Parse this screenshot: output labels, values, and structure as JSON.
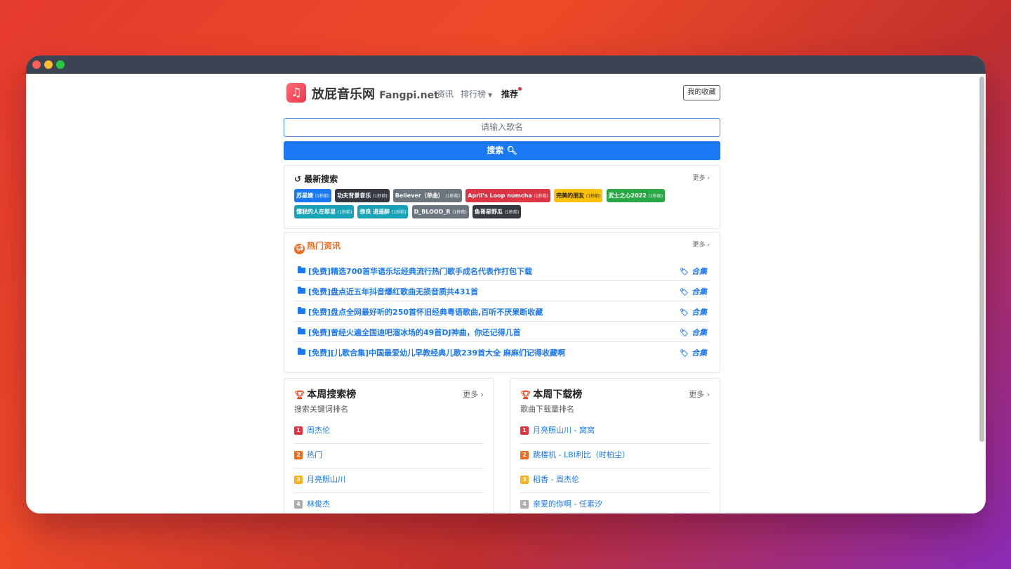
{
  "window": {
    "controls": [
      "close",
      "minimize",
      "maximize"
    ]
  },
  "nav": {
    "brand_cn": "放屁音乐网",
    "brand_en": "Fangpi.net",
    "logo_icon": "music-note-icon",
    "links": [
      "资讯",
      "排行榜",
      "推荐"
    ],
    "fav_button": "我的收藏"
  },
  "search": {
    "placeholder": "请输入歌名",
    "button_label": "搜索"
  },
  "recent": {
    "title": "最新搜索",
    "more": "更多",
    "tags": [
      {
        "name": "苏星婕",
        "time": "(1秒前)",
        "color": "#1a78f2"
      },
      {
        "name": "功夫背景音乐",
        "time": "(1秒前)",
        "color": "#343a40"
      },
      {
        "name": "Believer（单曲）",
        "time": "(1秒前)",
        "color": "#6c757d"
      },
      {
        "name": "April's Loop numcha",
        "time": "(1秒前)",
        "color": "#dc3545"
      },
      {
        "name": "完美的朋友",
        "time": "(1秒前)",
        "color": "#ffc107"
      },
      {
        "name": "武士之心2022",
        "time": "(1秒前)",
        "color": "#28a745"
      },
      {
        "name": "懂我的人在那里",
        "time": "(1秒前)",
        "color": "#17a2b8"
      },
      {
        "name": "徐良 逍遥醉",
        "time": "(1秒前)",
        "color": "#17a2b8"
      },
      {
        "name": "D_BLOOD_R",
        "time": "(1秒前)",
        "color": "#6c757d"
      },
      {
        "name": "鱼哥星野瓜",
        "time": "(1秒前)",
        "color": "#343a40"
      }
    ]
  },
  "hot": {
    "title": "热门资讯",
    "more": "更多",
    "items": [
      {
        "text": "[免费]精选700首华语乐坛经典流行热门歌手成名代表作打包下载",
        "tag": "合集"
      },
      {
        "text": "[免费]盘点近五年抖音爆红歌曲无损音质共431首",
        "tag": "合集"
      },
      {
        "text": "[免费]盘点全网最好听的250首怀旧经典粤语歌曲,百听不厌果断收藏",
        "tag": "合集"
      },
      {
        "text": "[免费]曾经火遍全国迪吧溜冰场的49首DJ神曲，你还记得几首",
        "tag": "合集"
      },
      {
        "text": "[免费][儿歌合集]中国最爱幼儿早教经典儿歌239首大全 麻麻们记得收藏啊",
        "tag": "合集"
      }
    ]
  },
  "weekly_search": {
    "title": "本周搜索榜",
    "subtitle": "搜索关键词排名",
    "more": "更多",
    "items": [
      {
        "rank": "1",
        "name": "周杰伦"
      },
      {
        "rank": "2",
        "name": "热门"
      },
      {
        "rank": "3",
        "name": "月亮照山川"
      },
      {
        "rank": "4",
        "name": "林俊杰"
      }
    ]
  },
  "weekly_download": {
    "title": "本周下载榜",
    "subtitle": "歌曲下载量排名",
    "more": "更多",
    "items": [
      {
        "rank": "1",
        "name": "月亮照山川 - 窝窝"
      },
      {
        "rank": "2",
        "name": "跳楼机 - LBI利比（时柏尘）"
      },
      {
        "rank": "3",
        "name": "稻香 - 周杰伦"
      },
      {
        "rank": "4",
        "name": "亲爱的你啊 - 任素汐"
      }
    ]
  },
  "colors": {
    "primary": "#1a78f2",
    "accent": "#f26b1d",
    "danger": "#dc3545"
  }
}
